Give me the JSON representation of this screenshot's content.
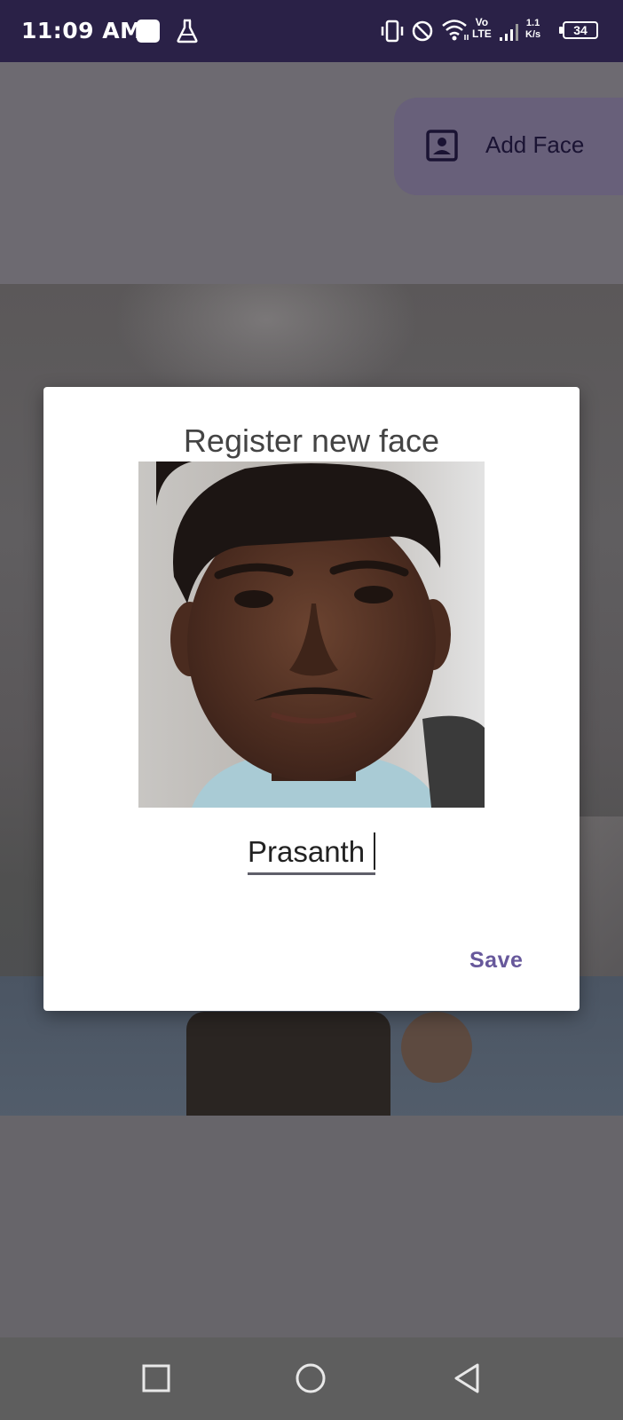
{
  "status_bar": {
    "time": "11:09 AM",
    "vo": "Vo",
    "lte": "LTE",
    "speed_value": "1.1",
    "speed_unit": "K/s",
    "battery": "34",
    "icons": [
      "notification-icon",
      "lab-flask-icon",
      "vibrate-icon",
      "do-not-disturb-icon",
      "wifi-icon",
      "volte-icon",
      "signal-icon",
      "battery-icon"
    ]
  },
  "app": {
    "fab_label": "Add Face",
    "fab_icon": "contact-portrait-icon"
  },
  "dialog": {
    "title": "Register new face",
    "photo_alt": "captured face",
    "name_value": "Prasanth",
    "save_label": "Save"
  },
  "nav_bar": {
    "icons": [
      "recents-square-icon",
      "home-circle-icon",
      "back-triangle-icon"
    ]
  },
  "colors": {
    "status_bar_bg": "#2a2147",
    "accent": "#67589b",
    "fab_bg": "#68607a"
  }
}
